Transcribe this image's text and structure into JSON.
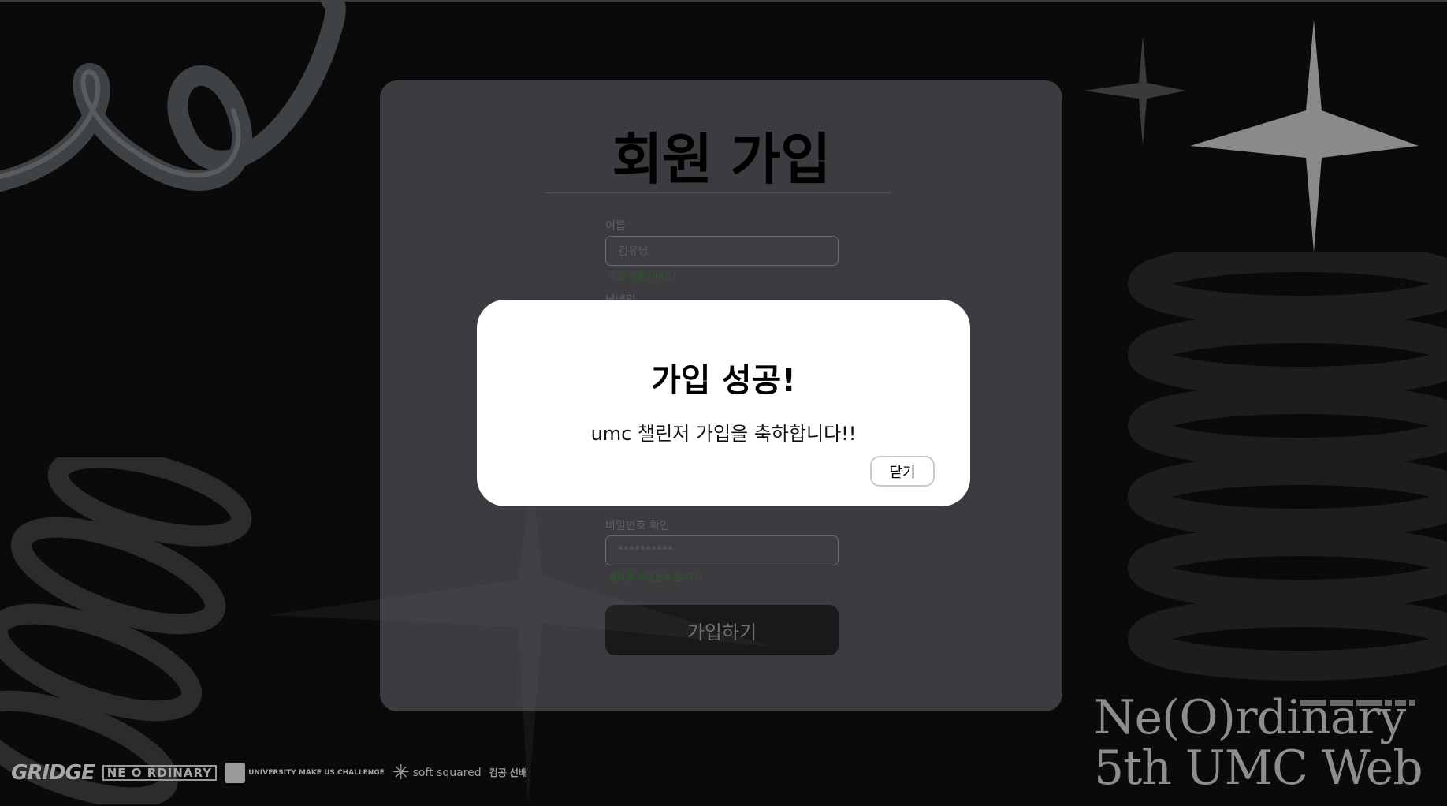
{
  "signup": {
    "title": "회원 가입",
    "fields": [
      {
        "label": "이름",
        "value": "김유닝",
        "message": "멋진 이름이네요!"
      },
      {
        "label": "닉네임"
      },
      {
        "label": "비밀번호 확인",
        "value": "**********",
        "message": "올바른 비밀번호입니다!"
      }
    ],
    "submit_label": "가입하기"
  },
  "modal": {
    "title": "가입 성공!",
    "message": "umc 챌린저 가입을 축하합니다!!",
    "close_label": "닫기"
  },
  "branding": {
    "line1": "Ne(O)rdinary",
    "line2": "5th UMC Web",
    "sponsors": [
      "GRIDGE",
      "NE O RDINARY",
      "UNIVERSITY MAKE US CHALLENGE",
      "soft squared",
      "컴공 선배"
    ]
  },
  "colors": {
    "background": "#0a0a0a",
    "card": "#3b3b40",
    "modal": "#ffffff",
    "success_text": "#2e5a2a",
    "submit_button": "#19191b"
  }
}
